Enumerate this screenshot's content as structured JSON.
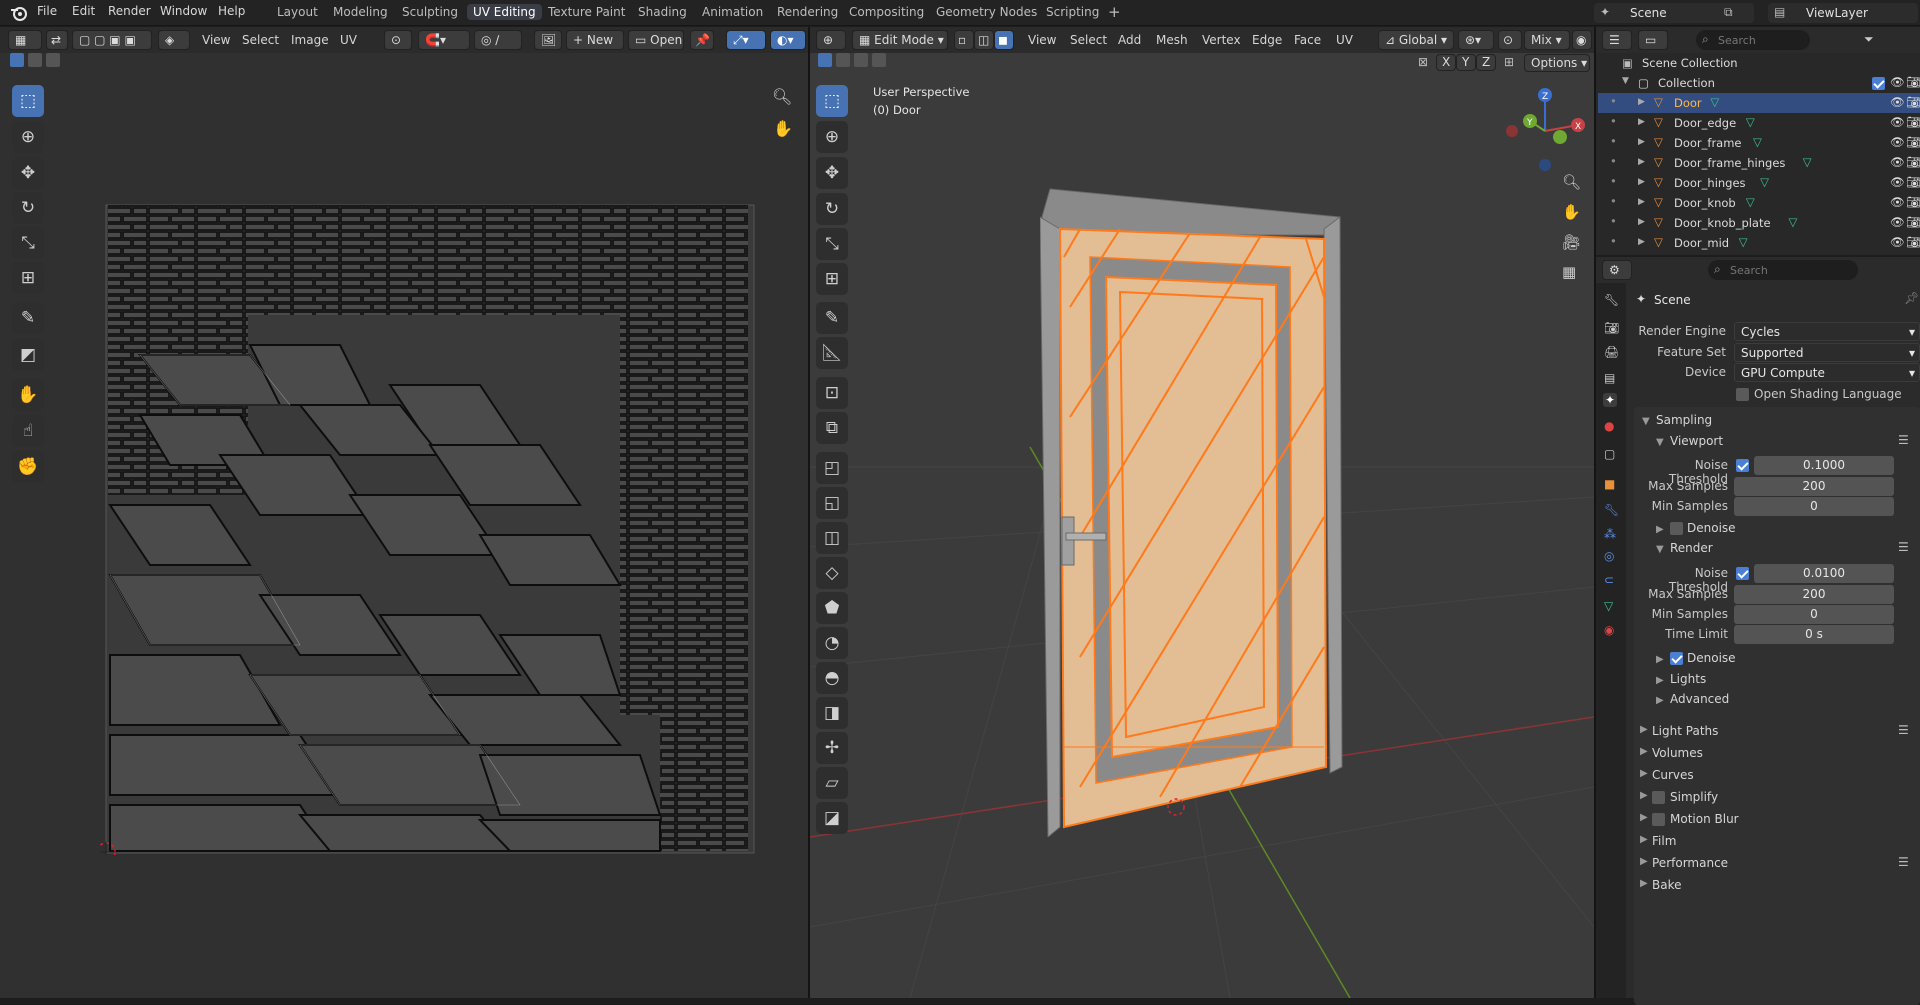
{
  "topbar": {
    "menus": [
      "File",
      "Edit",
      "Render",
      "Window",
      "Help"
    ],
    "workspaces": [
      "Layout",
      "Modeling",
      "Sculpting",
      "UV Editing",
      "Texture Paint",
      "Shading",
      "Animation",
      "Rendering",
      "Compositing",
      "Geometry Nodes",
      "Scripting"
    ],
    "active_workspace": "UV Editing",
    "add_tab": "+",
    "scene": "Scene",
    "view_layer": "ViewLayer"
  },
  "uv_editor": {
    "menus": [
      "View",
      "Select",
      "Image",
      "UV"
    ],
    "new_label": "New",
    "open_label": "Open"
  },
  "viewport": {
    "mode": "Edit Mode",
    "menus": [
      "View",
      "Select",
      "Add",
      "Mesh",
      "Vertex",
      "Edge",
      "Face",
      "UV"
    ],
    "orientation": "Global",
    "shading": "Mix",
    "options_label": "Options",
    "axes": [
      "X",
      "Y",
      "Z"
    ],
    "perspective_label": "User Perspective",
    "object_label": "(0) Door",
    "gizmo": {
      "x": "X",
      "y": "Y",
      "z": "Z"
    }
  },
  "outliner": {
    "search_placeholder": "Search",
    "root": "Scene Collection",
    "collection": "Collection",
    "items": [
      "Door",
      "Door_edge",
      "Door_frame",
      "Door_frame_hinges",
      "Door_hinges",
      "Door_knob",
      "Door_knob_plate",
      "Door_mid"
    ],
    "selected": "Door"
  },
  "properties": {
    "search_placeholder": "Search",
    "context": "Scene",
    "render_engine_label": "Render Engine",
    "render_engine": "Cycles",
    "feature_set_label": "Feature Set",
    "feature_set": "Supported",
    "device_label": "Device",
    "device": "GPU Compute",
    "osl_label": "Open Shading Language",
    "sampling": "Sampling",
    "viewport": {
      "title": "Viewport",
      "noise_threshold_label": "Noise Threshold",
      "noise_threshold": "0.1000",
      "max_samples_label": "Max Samples",
      "max_samples": "200",
      "min_samples_label": "Min Samples",
      "min_samples": "0",
      "denoise_label": "Denoise"
    },
    "render": {
      "title": "Render",
      "noise_threshold_label": "Noise Threshold",
      "noise_threshold": "0.0100",
      "max_samples_label": "Max Samples",
      "max_samples": "200",
      "min_samples_label": "Min Samples",
      "min_samples": "0",
      "time_limit_label": "Time Limit",
      "time_limit": "0 s",
      "denoise_label": "Denoise"
    },
    "sub_sections": [
      "Lights",
      "Advanced"
    ],
    "sections": [
      "Light Paths",
      "Volumes",
      "Curves",
      "Simplify",
      "Motion Blur",
      "Film",
      "Performance",
      "Bake"
    ]
  },
  "colors": {
    "accent": "#4772b3",
    "selection": "#ff7a1a",
    "object_icon": "#e8903a",
    "mesh_icon": "#3fbf8f"
  }
}
